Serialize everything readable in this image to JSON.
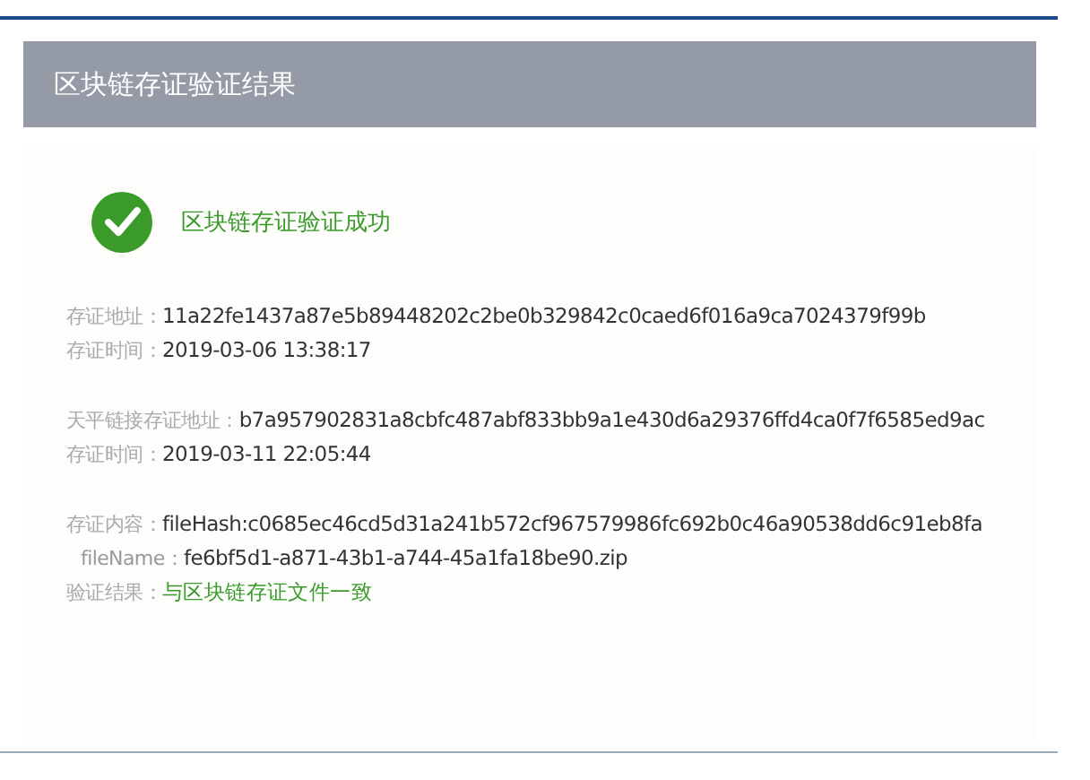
{
  "header": {
    "title": "区块链存证验证结果"
  },
  "result": {
    "success": true,
    "message": "区块链存证验证成功"
  },
  "groups": [
    {
      "rows": [
        {
          "label": "存证地址：",
          "value": "11a22fe1437a87e5b89448202c2be0b329842c0caed6f016a9ca7024379f99b",
          "kind": "plain"
        },
        {
          "label": "存证时间：",
          "value": "2019-03-06 13:38:17",
          "kind": "plain"
        }
      ]
    },
    {
      "rows": [
        {
          "label": "天平链接存证地址：",
          "value": "b7a957902831a8cbfc487abf833bb9a1e430d6a29376ffd4ca0f7f6585ed9ac",
          "kind": "plain"
        },
        {
          "label": "存证时间：",
          "value": "2019-03-11 22:05:44",
          "kind": "plain"
        }
      ]
    },
    {
      "rows": [
        {
          "label": "存证内容：",
          "value": "fileHash:c0685ec46cd5d31a241b572cf967579986fc692b0c46a90538dd6c91eb8fa",
          "kind": "plain"
        },
        {
          "label": "fileName：",
          "value": "fe6bf5d1-a871-43b1-a744-45a1fa18be90.zip",
          "kind": "indent"
        },
        {
          "label": "验证结果：",
          "value": "与区块链存证文件一致",
          "kind": "success"
        }
      ]
    }
  ]
}
